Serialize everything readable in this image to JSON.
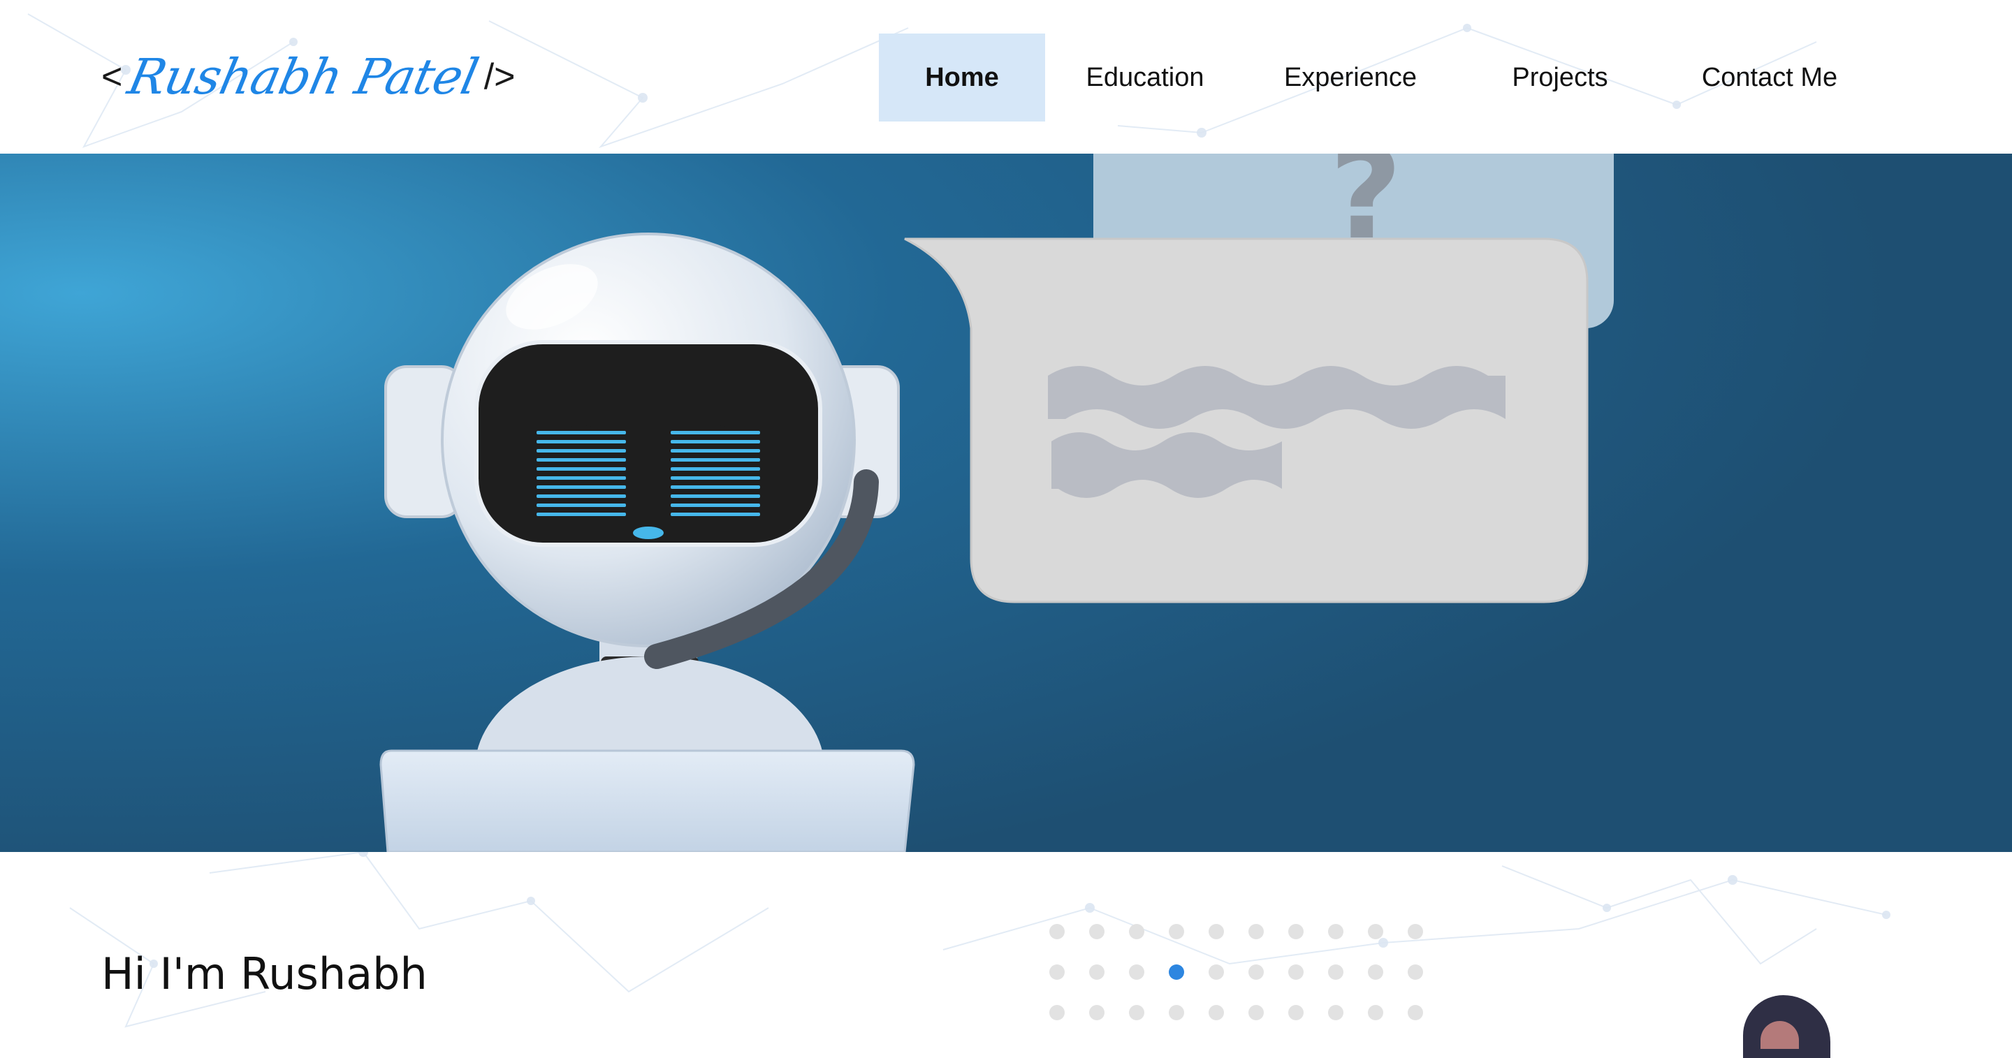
{
  "header": {
    "logo": {
      "open": "<",
      "name": "Rushabh Patel",
      "close": "/>"
    },
    "nav": [
      {
        "label": "Home",
        "active": true
      },
      {
        "label": "Education",
        "active": false
      },
      {
        "label": "Experience",
        "active": false
      },
      {
        "label": "Projects",
        "active": false
      },
      {
        "label": "Contact Me",
        "active": false
      }
    ]
  },
  "hero": {
    "question_mark": "?",
    "illustration": "chatbot-robot-with-headset-and-speech-bubble"
  },
  "intro": {
    "greeting": "Hi I'm Rushabh"
  },
  "carousel": {
    "active_index": 13,
    "rows": 3,
    "cols": 10
  },
  "colors": {
    "accent": "#1f86e6",
    "nav_active_bg": "#d6e7f8",
    "hero_dark": "#1e4f72",
    "hero_light": "#3fa5d6"
  }
}
